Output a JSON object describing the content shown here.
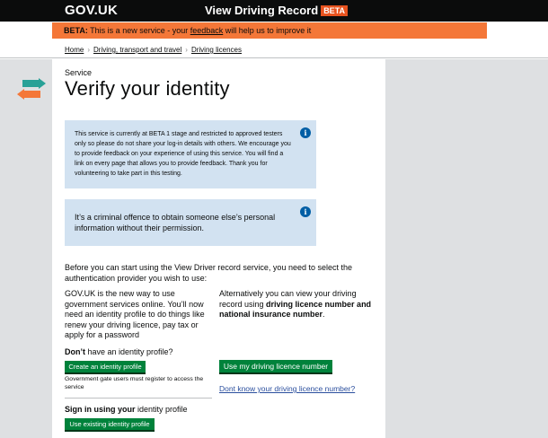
{
  "header": {
    "logo": "GOV.UK",
    "service_name": "View Driving Record",
    "badge": "BETA"
  },
  "beta_banner": {
    "label": "BETA:",
    "text_before": " This is a new service - your ",
    "link": "feedback",
    "text_after": " will help us to improve it"
  },
  "breadcrumbs": [
    "Home",
    "Driving, transport and travel",
    "Driving licences"
  ],
  "page": {
    "eyebrow": "Service",
    "title": "Verify your identity"
  },
  "info_boxes": [
    {
      "text": "This service is currently at BETA 1 stage and restricted to approved testers only so please do not share your log-in details with others. We encourage you to provide feedback on your experience of using this service. You will find a link on every page that allows you to provide feedback. Thank you for volunteering to take part in this testing."
    },
    {
      "text": "It’s a criminal offence to obtain someone else’s personal information without their permission."
    }
  ],
  "intro": "Before you can start using the View Driver record service, you need to select the authentication provider you wish to use:",
  "left_column": {
    "text": "GOV.UK is the new way to use government services online. You’ll now need an identity profile to do things like renew your driving licence, pay tax or apply for a password",
    "question_bold": "Don’t",
    "question_rest": " have an identity profile?",
    "create_button": "Create an identity profile",
    "note": "Government gate users must register to access the service",
    "signin_bold": "Sign in using your",
    "signin_rest": " identity profile",
    "existing_button": "Use existing identity profile"
  },
  "right_column": {
    "text_before": "Alternatively you can view your driving record using ",
    "text_bold": "driving licence number and national insurance number",
    "text_after": ".",
    "licence_button": "Use my driving licence number",
    "link": "Dont know your driving licence number?"
  },
  "colors": {
    "header_bg": "#0b0c0c",
    "beta_bg": "#f47738",
    "info_bg": "#d2e2f1",
    "button_green": "#00823b",
    "link_blue": "#2b4f9e",
    "page_bg": "#dee0e2",
    "arrow_orange": "#f47738",
    "arrow_teal": "#28a197"
  },
  "icons": {
    "swap": "swap-arrows-icon",
    "info": "info-icon"
  }
}
